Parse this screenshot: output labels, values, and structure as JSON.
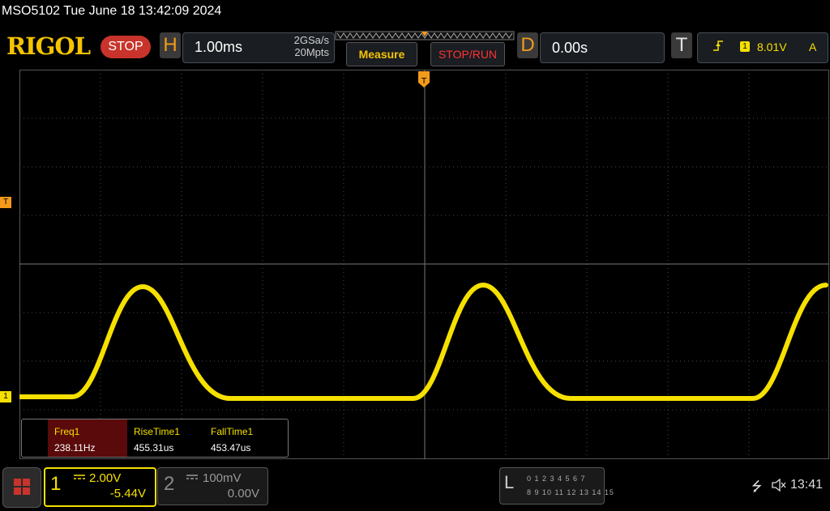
{
  "title": "MSO5102  Tue June 18 13:42:09 2024",
  "header": {
    "logo": "RIGOL",
    "run_state": "STOP",
    "h_letter": "H",
    "h_timebase": "1.00ms",
    "sample_rate": "2GSa/s",
    "mem_depth": "20Mpts",
    "measure_label": "Measure",
    "stoprun_label": "STOP/RUN",
    "d_letter": "D",
    "delay": "0.00s",
    "t_letter": "T",
    "trigger_channel": "1",
    "trigger_level": "8.01V",
    "trigger_mode": "A"
  },
  "screen": {
    "trigger_marker": "T",
    "ch1_marker": "1",
    "trigger_pos_marker": "T"
  },
  "measurements": [
    {
      "name": "Freq1",
      "value": "238.11Hz"
    },
    {
      "name": "RiseTime1",
      "value": "455.31us"
    },
    {
      "name": "FallTime1",
      "value": "453.47us"
    }
  ],
  "channels": {
    "ch1": {
      "num": "1",
      "scale": "2.00V",
      "offset": "-5.44V",
      "color": "#f5e000"
    },
    "ch2": {
      "num": "2",
      "scale": "100mV",
      "offset": "0.00V",
      "color": "#888888"
    }
  },
  "la": {
    "letter": "L",
    "row1": "0 1 2 3   4 5 6 7",
    "row2": "8 9 10 11 12 13 14 15"
  },
  "status": {
    "usb_icon": "usb-icon",
    "mute_icon": "speaker-mute-icon",
    "clock": "13:41"
  },
  "colors": {
    "trace": "#f5e000",
    "trigger": "#f39a1b",
    "stop": "#c8342b"
  }
}
